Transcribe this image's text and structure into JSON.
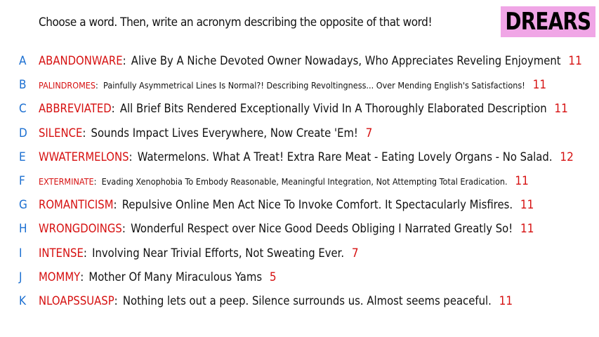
{
  "header": {
    "prompt": "Choose a word. Then, write an acronym describing the opposite of that word!",
    "logo": "DREARS"
  },
  "colors": {
    "letter": "#1b6fd1",
    "word": "#d61010",
    "count": "#d61010",
    "text": "#111111",
    "logo_bg": "#f0a6e6"
  },
  "entries": [
    {
      "letter": "A",
      "word": "ABANDONWARE",
      "acronym": "Alive By A Niche Devoted Owner Nowadays, Who Appreciates Reveling Enjoyment",
      "count": "11"
    },
    {
      "letter": "B",
      "word": "PALINDROMES",
      "acronym": "Painfully Asymmetrical Lines Is Normal?! Describing Revoltingness... Over Mending English's Satisfactions!",
      "count": "11"
    },
    {
      "letter": "C",
      "word": "ABBREVIATED",
      "acronym": "All Brief Bits Rendered Exceptionally Vivid In A Thoroughly Elaborated Description",
      "count": "11"
    },
    {
      "letter": "D",
      "word": "SILENCE",
      "acronym": "Sounds Impact Lives Everywhere, Now Create 'Em!",
      "count": "7"
    },
    {
      "letter": "E",
      "word": "WWATERMELONS",
      "acronym": "Watermelons. What A Treat! Extra Rare Meat - Eating Lovely Organs - No Salad.",
      "count": "12"
    },
    {
      "letter": "F",
      "word": "EXTERMINATE",
      "acronym": "Evading Xenophobia To Embody Reasonable, Meaningful Integration, Not Attempting Total Eradication.",
      "count": "11"
    },
    {
      "letter": "G",
      "word": "ROMANTICISM",
      "acronym": "Repulsive Online Men Act Nice To Invoke Comfort. It Spectacularly Misfires.",
      "count": "11"
    },
    {
      "letter": "H",
      "word": "WRONGDOINGS",
      "acronym": "Wonderful Respect over Nice Good Deeds Obliging I Narrated Greatly So!",
      "count": "11"
    },
    {
      "letter": "I",
      "word": "INTENSE",
      "acronym": "Involving Near Trivial Efforts, Not Sweating Ever.",
      "count": "7"
    },
    {
      "letter": "J",
      "word": "MOMMY",
      "acronym": "Mother Of Many Miraculous Yams",
      "count": "5"
    },
    {
      "letter": "K",
      "word": "NLOAPSSUASP",
      "acronym": "Nothing lets out a peep. Silence surrounds us. Almost seems peaceful.",
      "count": "11"
    }
  ]
}
